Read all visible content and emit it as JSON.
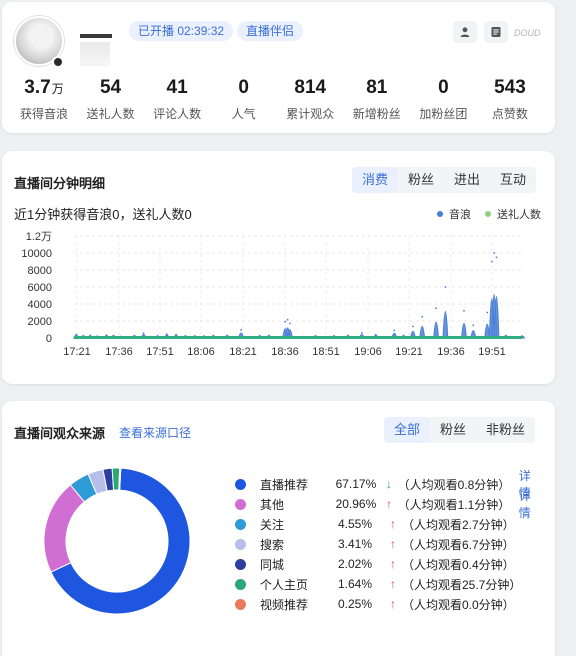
{
  "header": {
    "live_badge": "已开播 02:39:32",
    "partner_badge": "直播伴侣",
    "douyin_label": "DOUD",
    "stats": [
      {
        "value": "3.7",
        "unit": "万",
        "label": "获得音浪"
      },
      {
        "value": "54",
        "unit": "",
        "label": "送礼人数"
      },
      {
        "value": "41",
        "unit": "",
        "label": "评论人数"
      },
      {
        "value": "0",
        "unit": "",
        "label": "人气"
      },
      {
        "value": "814",
        "unit": "",
        "label": "累计观众"
      },
      {
        "value": "81",
        "unit": "",
        "label": "新增粉丝"
      },
      {
        "value": "0",
        "unit": "",
        "label": "加粉丝团"
      },
      {
        "value": "543",
        "unit": "",
        "label": "点赞数"
      }
    ]
  },
  "minute": {
    "title": "直播间分钟明细",
    "tabs": [
      {
        "label": "消费",
        "active": true
      },
      {
        "label": "粉丝",
        "active": false
      },
      {
        "label": "进出",
        "active": false
      },
      {
        "label": "互动",
        "active": false
      }
    ],
    "subline": "近1分钟获得音浪0，送礼人数0",
    "legend": [
      {
        "label": "音浪",
        "color": "#4a7fd6"
      },
      {
        "label": "送礼人数",
        "color": "#8fd17a"
      }
    ]
  },
  "chart_data": {
    "type": "area",
    "y_ticks": [
      "0",
      "2000",
      "4000",
      "6000",
      "8000",
      "10000",
      "1.2万"
    ],
    "ylim": [
      0,
      12000
    ],
    "x_ticks": [
      "17:21",
      "17:36",
      "17:51",
      "18:06",
      "18:21",
      "18:36",
      "18:51",
      "19:06",
      "19:21",
      "19:36",
      "19:51"
    ],
    "x_range_minutes": [
      0,
      163
    ],
    "series": [
      {
        "name": "音浪",
        "color": "#4a7fd6",
        "points": [
          [
            1,
            400
          ],
          [
            4,
            260
          ],
          [
            7,
            300
          ],
          [
            10,
            200
          ],
          [
            14,
            320
          ],
          [
            17,
            300
          ],
          [
            20,
            180
          ],
          [
            26,
            280
          ],
          [
            30,
            550
          ],
          [
            33,
            150
          ],
          [
            36,
            250
          ],
          [
            40,
            460
          ],
          [
            44,
            380
          ],
          [
            48,
            250
          ],
          [
            52,
            250
          ],
          [
            56,
            220
          ],
          [
            60,
            300
          ],
          [
            66,
            300
          ],
          [
            72,
            950
          ],
          [
            80,
            260
          ],
          [
            84,
            300
          ],
          [
            91,
            1900
          ],
          [
            92,
            2150
          ],
          [
            93,
            1700
          ],
          [
            99,
            150
          ],
          [
            104,
            250
          ],
          [
            112,
            250
          ],
          [
            118,
            300
          ],
          [
            124,
            600
          ],
          [
            130,
            380
          ],
          [
            138,
            880
          ],
          [
            142,
            300
          ],
          [
            146,
            1350
          ],
          [
            150,
            2500
          ],
          [
            156,
            3500
          ],
          [
            160,
            6000
          ],
          [
            168,
            3200
          ],
          [
            172,
            1500
          ],
          [
            178,
            3000
          ],
          [
            180,
            9000
          ],
          [
            181,
            10000
          ],
          [
            182,
            9500
          ],
          [
            186,
            300
          ],
          [
            193,
            220
          ]
        ]
      },
      {
        "name": "送礼人数",
        "color": "#2fae84",
        "points": []
      }
    ]
  },
  "source": {
    "title": "直播间观众来源",
    "path_link": "查看来源口径",
    "tabs": [
      {
        "label": "全部",
        "active": true
      },
      {
        "label": "粉丝",
        "active": false
      },
      {
        "label": "非粉丝",
        "active": false
      }
    ],
    "rows": [
      {
        "name": "直播推荐",
        "pct": "67.17%",
        "value": 67.17,
        "color": "#1f56e0",
        "trend": "down",
        "avg": "（人均观看0.8分钟）",
        "detail": "详情"
      },
      {
        "name": "其他",
        "pct": "20.96%",
        "value": 20.96,
        "color": "#d16ed3",
        "trend": "up",
        "avg": "（人均观看1.1分钟）",
        "detail": "详情"
      },
      {
        "name": "关注",
        "pct": "4.55%",
        "value": 4.55,
        "color": "#2f9bd6",
        "trend": "up",
        "avg": "（人均观看2.7分钟）",
        "detail": ""
      },
      {
        "name": "搜索",
        "pct": "3.41%",
        "value": 3.41,
        "color": "#b7bee8",
        "trend": "up",
        "avg": "（人均观看6.7分钟）",
        "detail": ""
      },
      {
        "name": "同城",
        "pct": "2.02%",
        "value": 2.02,
        "color": "#2b3f9e",
        "trend": "up",
        "avg": "（人均观看0.4分钟）",
        "detail": ""
      },
      {
        "name": "个人主页",
        "pct": "1.64%",
        "value": 1.64,
        "color": "#2aa876",
        "trend": "up",
        "avg": "（人均观看25.7分钟）",
        "detail": ""
      },
      {
        "name": "视频推荐",
        "pct": "0.25%",
        "value": 0.25,
        "color": "#ee7a5c",
        "trend": "up",
        "avg": "（人均观看0.0分钟）",
        "detail": ""
      }
    ]
  }
}
